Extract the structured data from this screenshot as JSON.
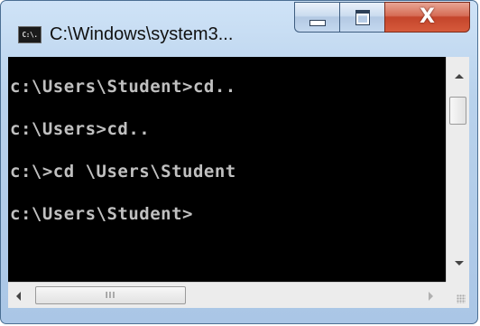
{
  "window": {
    "title": "C:\\Windows\\system3...",
    "icon": "cmd-icon",
    "icon_text": "C:\\."
  },
  "caption_buttons": {
    "minimize_icon": "minimize-icon",
    "maximize_icon": "maximize-icon",
    "close_glyph": "X"
  },
  "console": {
    "lines": [
      "c:\\Users\\Student>cd..",
      "c:\\Users>cd..",
      "c:\\>cd \\Users\\Student",
      "c:\\Users\\Student>"
    ]
  },
  "scrollbars": {
    "horizontal_grip": "III",
    "vertical_thumb_position": 0.15,
    "horizontal_thumb_position": 0.0
  },
  "colors": {
    "console_background": "#000000",
    "console_text": "#c0c0c0",
    "close_button": "#c4452b",
    "title_frame": "#aac6e6"
  }
}
